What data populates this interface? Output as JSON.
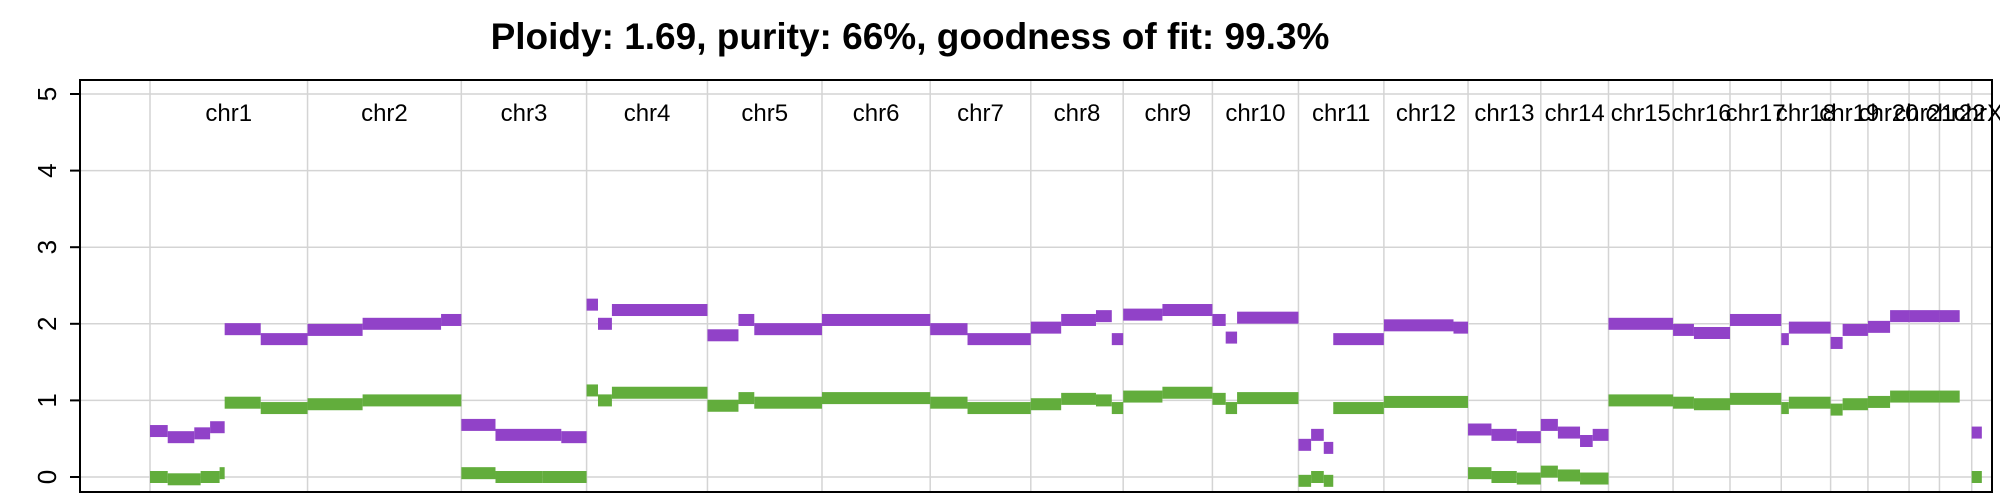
{
  "chart_data": {
    "type": "segment",
    "title": "Ploidy: 1.69, purity: 66%, goodness of fit: 99.3%",
    "ylim": [
      0,
      5
    ],
    "yticks": [
      "0",
      "1",
      "2",
      "3",
      "4",
      "5"
    ],
    "grid": true,
    "chromosomes": [
      "chr1",
      "chr2",
      "chr3",
      "chr4",
      "chr5",
      "chr6",
      "chr7",
      "chr8",
      "chr9",
      "chr10",
      "chr11",
      "chr12",
      "chr13",
      "chr14",
      "chr15",
      "chr16",
      "chr17",
      "chr18",
      "chr19",
      "chr20",
      "chr21",
      "chr22",
      "chrX"
    ],
    "chromosome_bounds": [
      0,
      249,
      492,
      690,
      881,
      1062,
      1233,
      1392,
      1538,
      1679,
      1815,
      1950,
      2083,
      2198,
      2305,
      2407,
      2497,
      2578,
      2656,
      2715,
      2780,
      2828,
      2879,
      2900
    ],
    "series": [
      {
        "name": "total",
        "color": "#9142c8",
        "segments": [
          [
            0,
            28,
            0.6
          ],
          [
            28,
            70,
            0.52
          ],
          [
            70,
            95,
            0.57
          ],
          [
            95,
            118,
            0.65
          ],
          [
            118,
            175,
            1.93
          ],
          [
            175,
            249,
            1.8
          ],
          [
            249,
            336,
            1.92
          ],
          [
            336,
            460,
            2.0
          ],
          [
            460,
            492,
            2.05
          ],
          [
            492,
            546,
            0.68
          ],
          [
            546,
            650,
            0.55
          ],
          [
            650,
            690,
            0.52
          ],
          [
            690,
            708,
            2.25
          ],
          [
            708,
            730,
            2.0
          ],
          [
            730,
            881,
            2.18
          ],
          [
            881,
            930,
            1.85
          ],
          [
            930,
            955,
            2.05
          ],
          [
            955,
            1062,
            1.93
          ],
          [
            1062,
            1233,
            2.05
          ],
          [
            1233,
            1292,
            1.93
          ],
          [
            1292,
            1392,
            1.8
          ],
          [
            1392,
            1440,
            1.95
          ],
          [
            1440,
            1495,
            2.05
          ],
          [
            1495,
            1520,
            2.1
          ],
          [
            1520,
            1538,
            1.8
          ],
          [
            1538,
            1600,
            2.12
          ],
          [
            1600,
            1679,
            2.18
          ],
          [
            1679,
            1700,
            2.05
          ],
          [
            1700,
            1718,
            1.82
          ],
          [
            1718,
            1815,
            2.08
          ],
          [
            1815,
            1835,
            0.42
          ],
          [
            1835,
            1855,
            0.55
          ],
          [
            1855,
            1870,
            0.38
          ],
          [
            1870,
            1950,
            1.8
          ],
          [
            1950,
            2060,
            1.98
          ],
          [
            2060,
            2083,
            1.95
          ],
          [
            2083,
            2120,
            0.62
          ],
          [
            2120,
            2160,
            0.55
          ],
          [
            2160,
            2198,
            0.52
          ],
          [
            2198,
            2225,
            0.68
          ],
          [
            2225,
            2260,
            0.58
          ],
          [
            2260,
            2280,
            0.47
          ],
          [
            2280,
            2305,
            0.55
          ],
          [
            2305,
            2407,
            2.0
          ],
          [
            2407,
            2440,
            1.92
          ],
          [
            2440,
            2497,
            1.88
          ],
          [
            2497,
            2578,
            2.05
          ],
          [
            2578,
            2590,
            1.8
          ],
          [
            2590,
            2656,
            1.95
          ],
          [
            2656,
            2675,
            1.75
          ],
          [
            2675,
            2715,
            1.92
          ],
          [
            2715,
            2750,
            1.96
          ],
          [
            2750,
            2780,
            2.1
          ],
          [
            2780,
            2828,
            2.1
          ],
          [
            2828,
            2860,
            2.1
          ],
          [
            2879,
            2895,
            0.58
          ]
        ]
      },
      {
        "name": "minor",
        "color": "#62ad3c",
        "segments": [
          [
            0,
            28,
            0.0
          ],
          [
            28,
            80,
            -0.03
          ],
          [
            80,
            110,
            0.0
          ],
          [
            110,
            118,
            0.05
          ],
          [
            118,
            175,
            0.97
          ],
          [
            175,
            249,
            0.9
          ],
          [
            249,
            336,
            0.95
          ],
          [
            336,
            492,
            1.0
          ],
          [
            492,
            546,
            0.05
          ],
          [
            546,
            620,
            0.0
          ],
          [
            620,
            690,
            0.0
          ],
          [
            690,
            708,
            1.13
          ],
          [
            708,
            730,
            1.0
          ],
          [
            730,
            881,
            1.1
          ],
          [
            881,
            930,
            0.93
          ],
          [
            930,
            955,
            1.03
          ],
          [
            955,
            1062,
            0.97
          ],
          [
            1062,
            1233,
            1.03
          ],
          [
            1233,
            1292,
            0.97
          ],
          [
            1292,
            1392,
            0.9
          ],
          [
            1392,
            1440,
            0.95
          ],
          [
            1440,
            1495,
            1.02
          ],
          [
            1495,
            1520,
            1.0
          ],
          [
            1520,
            1538,
            0.9
          ],
          [
            1538,
            1600,
            1.05
          ],
          [
            1600,
            1679,
            1.1
          ],
          [
            1679,
            1700,
            1.02
          ],
          [
            1700,
            1718,
            0.9
          ],
          [
            1718,
            1815,
            1.03
          ],
          [
            1815,
            1835,
            -0.05
          ],
          [
            1835,
            1855,
            0.0
          ],
          [
            1855,
            1870,
            -0.05
          ],
          [
            1870,
            1950,
            0.9
          ],
          [
            1950,
            2083,
            0.98
          ],
          [
            2083,
            2120,
            0.05
          ],
          [
            2120,
            2160,
            0.0
          ],
          [
            2160,
            2198,
            -0.02
          ],
          [
            2198,
            2225,
            0.07
          ],
          [
            2225,
            2260,
            0.02
          ],
          [
            2260,
            2305,
            -0.02
          ],
          [
            2305,
            2407,
            1.0
          ],
          [
            2407,
            2440,
            0.97
          ],
          [
            2440,
            2497,
            0.95
          ],
          [
            2497,
            2578,
            1.02
          ],
          [
            2578,
            2590,
            0.9
          ],
          [
            2590,
            2656,
            0.97
          ],
          [
            2656,
            2675,
            0.88
          ],
          [
            2675,
            2715,
            0.95
          ],
          [
            2715,
            2750,
            0.98
          ],
          [
            2750,
            2780,
            1.05
          ],
          [
            2780,
            2828,
            1.05
          ],
          [
            2828,
            2860,
            1.05
          ],
          [
            2879,
            2895,
            0.0
          ]
        ]
      }
    ]
  }
}
